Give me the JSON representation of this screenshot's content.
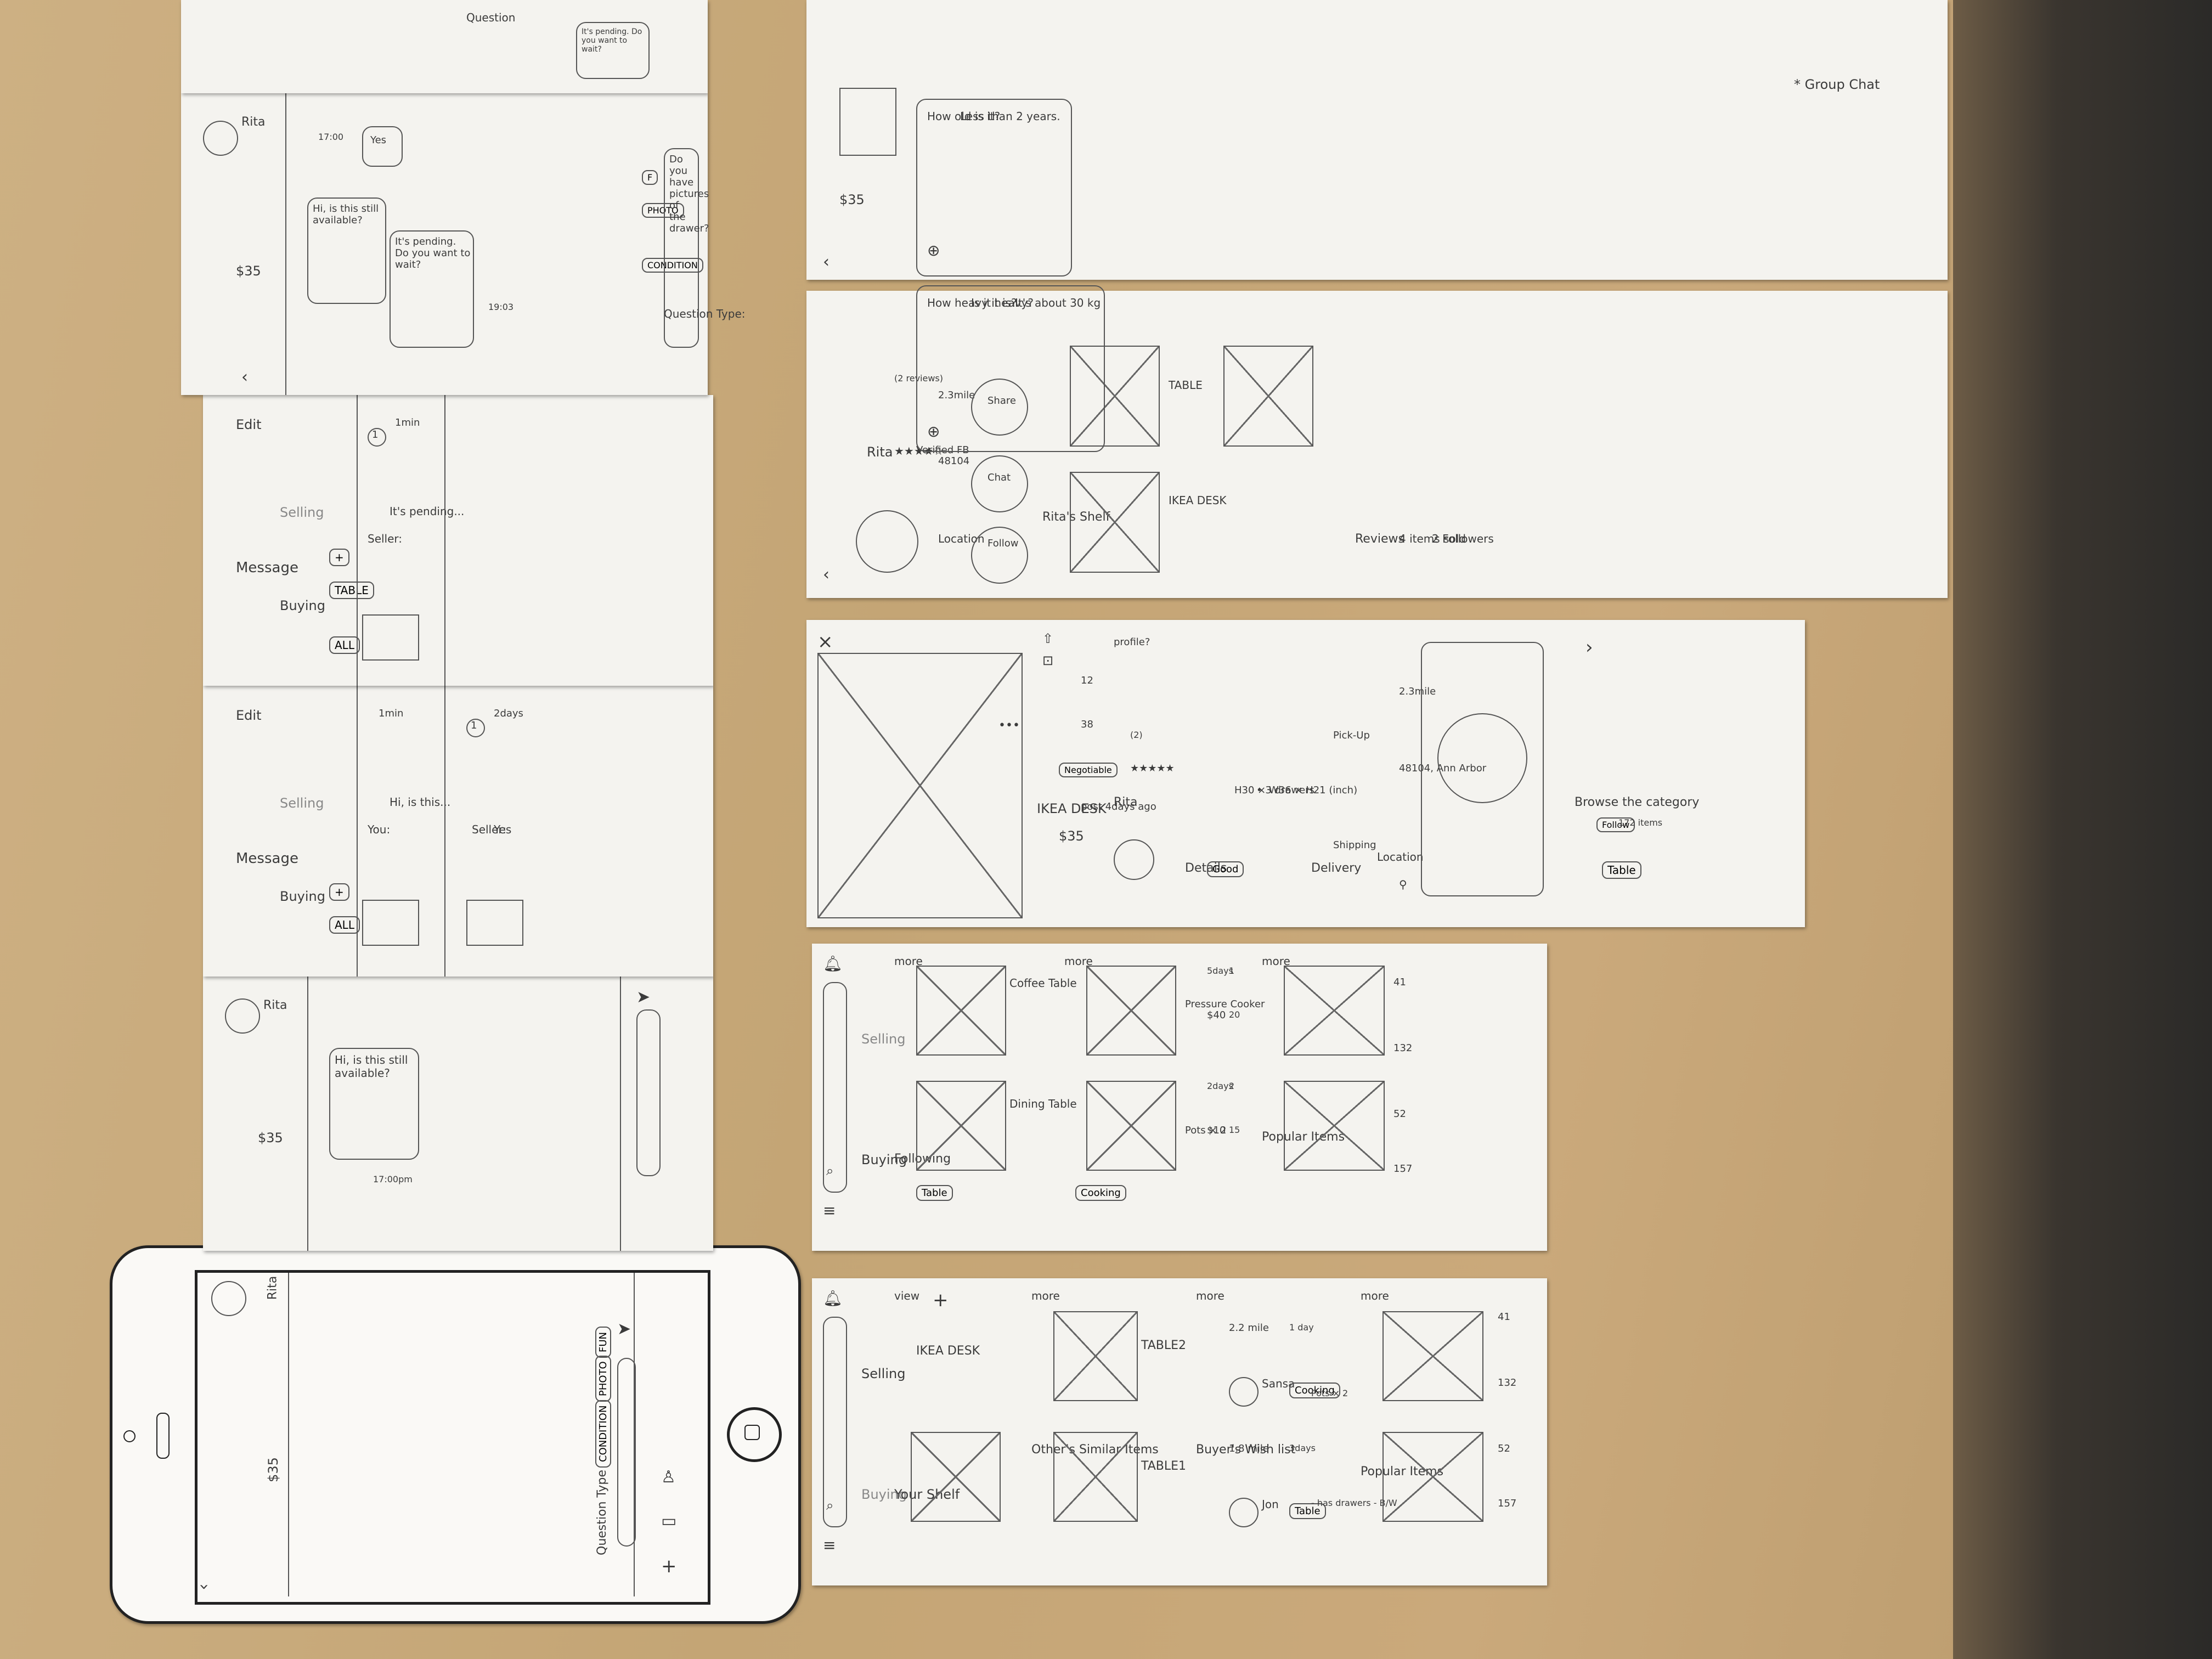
{
  "phone": {
    "price": "$35",
    "user": "Rita",
    "question_type_label": "Question Type",
    "chips": [
      "CONDITION",
      "PHOTO",
      "FUN"
    ]
  },
  "chat_screen": {
    "price": "$35",
    "user": "Rita",
    "bubble": "Hi, is this still available?",
    "time": "17:00pm"
  },
  "message_list_1": {
    "title": "Message",
    "edit": "Edit",
    "tabs": [
      "Buying",
      "Selling"
    ],
    "filters": [
      "ALL",
      "+"
    ],
    "items": [
      {
        "from": "You:",
        "text": "Hi, is this...",
        "time": "1min"
      },
      {
        "from": "Seller:",
        "text": "Yes",
        "time": "2days",
        "badge": "1"
      }
    ]
  },
  "message_list_2": {
    "title": "Message",
    "edit": "Edit",
    "tabs": [
      "Buying",
      "Selling"
    ],
    "filters": [
      "ALL",
      "TABLE",
      "+"
    ],
    "items": [
      {
        "from": "Seller:",
        "text": "It's pending...",
        "time": "1min",
        "badge": "1"
      }
    ]
  },
  "chat_full": {
    "price": "$35",
    "user": "Rita",
    "messages": [
      {
        "text": "Hi, is this still available?",
        "time": "17:00"
      },
      {
        "text": "Yes"
      },
      {
        "text": "It's pending. Do you want to wait?",
        "time": "19:03"
      }
    ],
    "question_type_label": "Question Type:",
    "chips": [
      "CONDITION",
      "PHOTO",
      "F"
    ],
    "input": "Do you have pictures of the drawer?"
  },
  "top_strip": {
    "question_label": "Question",
    "bubble": "It's pending. Do you want to wait?"
  },
  "home_selling": {
    "tabs": [
      "Buying",
      "Selling"
    ],
    "your_shelf": "Your Shelf",
    "view": "view",
    "shelf_items": [
      "IKEA DESK",
      "+"
    ],
    "similar_title": "Other's Similar Items",
    "more": "more",
    "similar_items": [
      "TABLE1",
      "TABLE2"
    ],
    "wishlist_title": "Buyer's Wish list",
    "buyers": [
      {
        "name": "Jon",
        "distance": "1.8 mile",
        "time": "3days",
        "tags": [
          "Table"
        ],
        "notes": "- has drawers - B/W"
      },
      {
        "name": "Sansa",
        "distance": "2.2 mile",
        "time": "1 day",
        "tags": [
          "Cooking"
        ],
        "notes": "Pots × 2"
      }
    ],
    "popular_title": "Popular Items",
    "stats": [
      "157",
      "52",
      "132",
      "41"
    ]
  },
  "home_buying": {
    "tabs": [
      "Buying",
      "Selling"
    ],
    "following": "Following",
    "table_tag": "Table",
    "more": "more",
    "items1": [
      "Dining Table",
      "Coffee Table"
    ],
    "cooking_tag": "Cooking",
    "items2": [
      {
        "title": "Pots × 2",
        "price": "$10",
        "age": "2days",
        "views": "15",
        "saves": "2"
      },
      {
        "title": "Pressure Cooker",
        "price": "$40",
        "age": "5days",
        "views": "20",
        "saves": "1"
      }
    ],
    "popular_title": "Popular Items",
    "stats": [
      "157",
      "52",
      "132",
      "41"
    ]
  },
  "product": {
    "close": "×",
    "title": "IKEA DESK",
    "price": "$35",
    "negotiable": "Negotiable",
    "posted": "post 4days ago",
    "views": "38",
    "saves": "12",
    "seller": "Rita",
    "reviews": "(2)",
    "profile": "profile?",
    "details_title": "Details",
    "condition": "Good",
    "dimensions": "H30 × W36 × H21 (inch)",
    "drawers": "• 3 drawers",
    "delivery_title": "Delivery",
    "shipping": "Shipping",
    "pickup": "Pick-Up",
    "location_title": "Location",
    "location": "48104, Ann Arbor",
    "distance": "2.3mile",
    "browse": "Browse the category",
    "category": "Table",
    "follow": "Follow",
    "count": "172 items"
  },
  "profile": {
    "name": "Rita",
    "reviews": "(2 reviews)",
    "verified": "Verified FB",
    "location_label": "Location",
    "location": "48104",
    "distance": "2.3mile",
    "actions": [
      "Follow",
      "Chat",
      "Share"
    ],
    "shelf_title": "Rita's Shelf",
    "shelf_items": [
      "IKEA DESK",
      "TABLE"
    ],
    "reviews_title": "Reviews",
    "sold": "4 items sold",
    "followers": "2 Followers"
  },
  "group_chat": {
    "price": "$35",
    "threads": [
      [
        "How old is it?",
        "Less than 2 years."
      ],
      [
        "How heavy it is?",
        "Is it heavy?",
        "It's about 30 kg"
      ]
    ],
    "note": "* Group Chat"
  }
}
